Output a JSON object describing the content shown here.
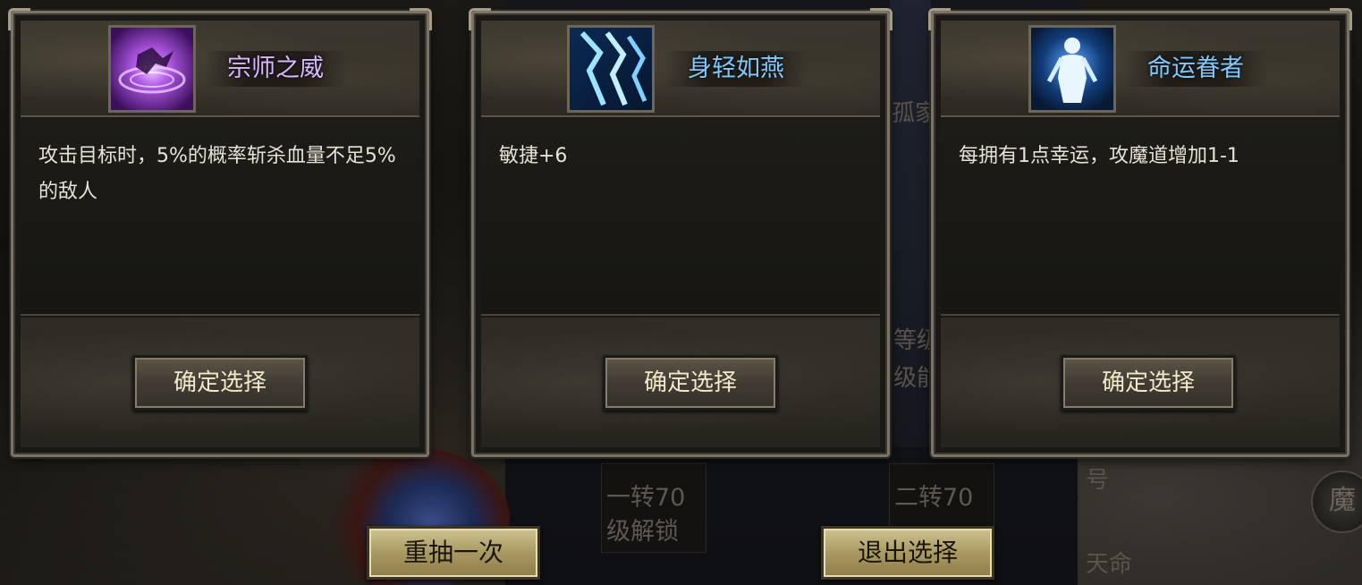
{
  "background": {
    "unlock_left_line1": "一转70",
    "unlock_left_line2": "级解锁",
    "unlock_right_line1": "二转70",
    "side_fragment_1": "孤家",
    "side_fragment_2": "等级",
    "side_fragment_3": "级能",
    "side_fragment_4": "号",
    "side_fragment_5": "天命",
    "badge_glyph": "魔"
  },
  "cards": [
    {
      "name": "宗师之威",
      "name_color": "#d9b6ff",
      "icon": "purple-vortex-icon",
      "description": "攻击目标时，5%的概率斩杀血量不足5%的敌人",
      "confirm_label": "确定选择"
    },
    {
      "name": "身轻如燕",
      "name_color": "#7fc8ff",
      "icon": "blue-lightning-icon",
      "description": "敏捷+6",
      "confirm_label": "确定选择"
    },
    {
      "name": "命运眷者",
      "name_color": "#7fc8ff",
      "icon": "glowing-figure-icon",
      "description": "每拥有1点幸运，攻魔道增加1-1",
      "confirm_label": "确定选择"
    }
  ],
  "footer": {
    "reroll_label": "重抽一次",
    "exit_label": "退出选择"
  }
}
